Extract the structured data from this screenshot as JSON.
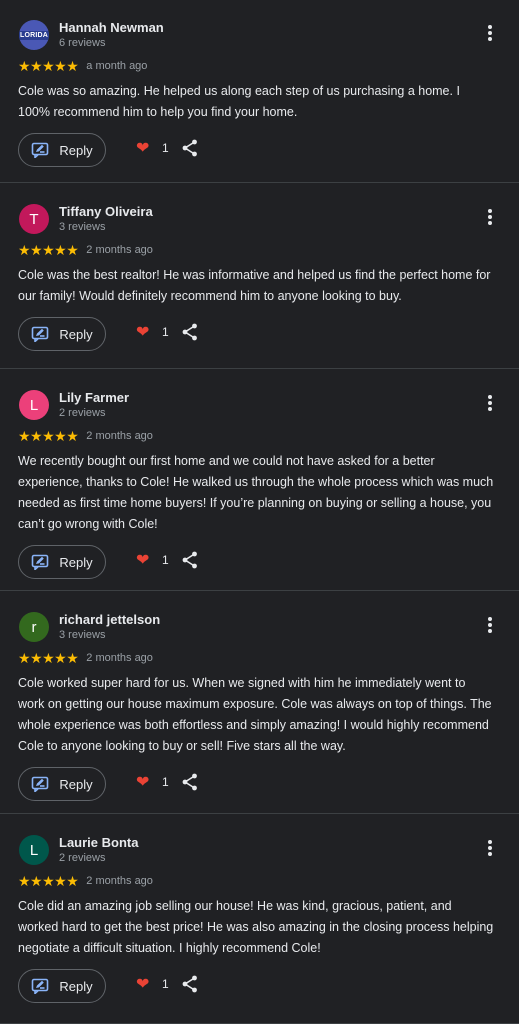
{
  "reviews": [
    {
      "name": "Hannah Newman",
      "count": "6 reviews",
      "avatar_text": "LORIDA",
      "avatar_color": "#4a58b5",
      "stars": "★★★★★",
      "when": "a month ago",
      "text": "Cole was so amazing. He helped us along each step of us purchasing a home. I 100% recommend him to help you find your home.",
      "reply_label": "Reply",
      "likes": "1"
    },
    {
      "name": "Tiffany Oliveira",
      "count": "3 reviews",
      "avatar_text": "T",
      "avatar_color": "#c2185b",
      "stars": "★★★★★",
      "when": "2 months ago",
      "text": "Cole was the best realtor! He was informative and helped us find the perfect home for our family! Would definitely recommend him to anyone looking to buy.",
      "reply_label": "Reply",
      "likes": "1"
    },
    {
      "name": "Lily Farmer",
      "count": "2 reviews",
      "avatar_text": "L",
      "avatar_color": "#ec407a",
      "stars": "★★★★★",
      "when": "2 months ago",
      "text": "We recently bought our first home and we could not have asked for a better experience, thanks to Cole! He walked us through the whole process which was much needed as first time home buyers! If you’re planning on buying or selling a house, you can’t go wrong with Cole!",
      "reply_label": "Reply",
      "likes": "1"
    },
    {
      "name": "richard jettelson",
      "count": "3 reviews",
      "avatar_text": "r",
      "avatar_color": "#33691e",
      "stars": "★★★★★",
      "when": "2 months ago",
      "text": "Cole worked super hard for us. When we signed with him he immediately went to work on getting our house maximum exposure. Cole was always on top of things. The whole experience was both effortless and simply amazing! I would highly recommend Cole to anyone looking to buy or sell! Five stars all the way.",
      "reply_label": "Reply",
      "likes": "1"
    },
    {
      "name": "Laurie Bonta",
      "count": "2 reviews",
      "avatar_text": "L",
      "avatar_color": "#00574b",
      "stars": "★★★★★",
      "when": "2 months ago",
      "text": "Cole did an amazing job selling our house! He was kind, gracious, patient, and worked hard to get the best price! He was also amazing in the closing process helping negotiate a difficult situation. I highly recommend Cole!",
      "reply_label": "Reply",
      "likes": "1"
    }
  ],
  "icons": {
    "reply": "reply-icon",
    "heart": "heart-icon",
    "share": "share-icon",
    "more": "more-vert-icon"
  }
}
